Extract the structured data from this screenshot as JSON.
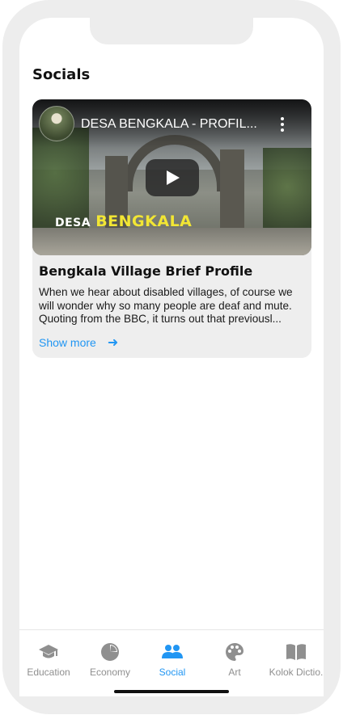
{
  "page": {
    "title": "Socials"
  },
  "card": {
    "video": {
      "title": "DESA BENGKALA - PROFIL...",
      "brand_word1": "DESA",
      "brand_word2": "BENGKALA"
    },
    "title": "Bengkala Village Brief Profile",
    "description": "When we hear about disabled villages, of course we will wonder why so many people are deaf and mute. Quoting from the BBC, it turns out that previousl...",
    "show_more": "Show more"
  },
  "nav": {
    "items": [
      {
        "label": "Education",
        "icon": "graduation-cap-icon"
      },
      {
        "label": "Economy",
        "icon": "pie-chart-icon"
      },
      {
        "label": "Social",
        "icon": "people-icon"
      },
      {
        "label": "Art",
        "icon": "palette-icon"
      },
      {
        "label": "Kolok Dictio.",
        "icon": "book-icon"
      }
    ],
    "active": "Social"
  },
  "colors": {
    "accent": "#2196f3",
    "inactive": "#8f8f8f",
    "card_bg": "#eeeeee",
    "frame": "#ededed"
  }
}
